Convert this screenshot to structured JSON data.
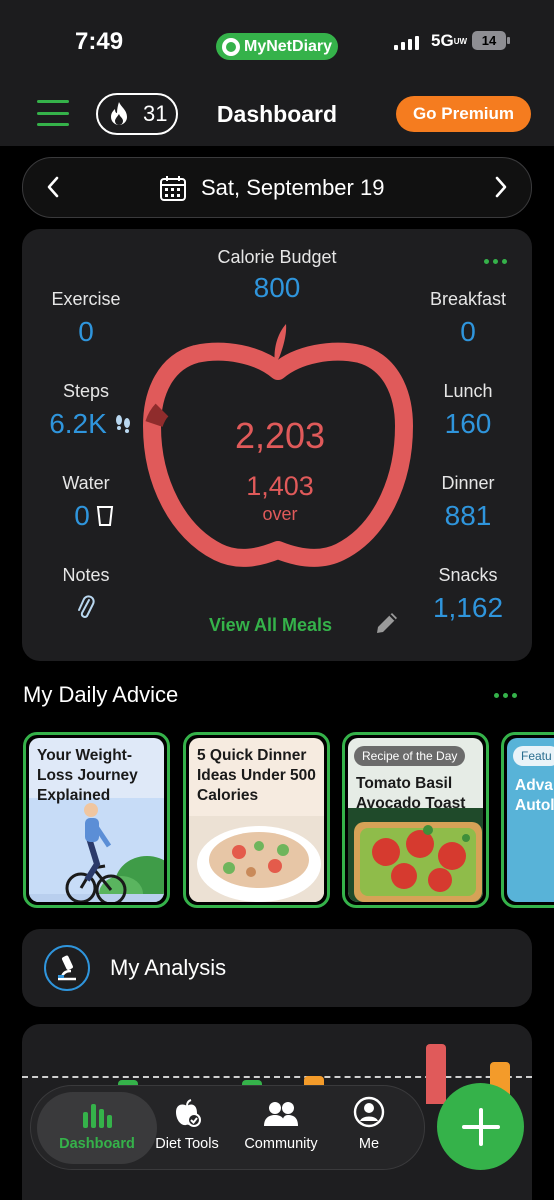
{
  "status_bar": {
    "time": "7:49",
    "app_name": "MyNetDiary",
    "network": "5G",
    "network_suffix": "UW",
    "battery": "14"
  },
  "header": {
    "title": "Dashboard",
    "streak_count": "31",
    "premium_label": "Go Premium"
  },
  "date_bar": {
    "date": "Sat, September 19"
  },
  "summary": {
    "calorie_budget_label": "Calorie Budget",
    "calorie_budget_value": "800",
    "exercise_label": "Exercise",
    "exercise_value": "0",
    "steps_label": "Steps",
    "steps_value": "6.2K",
    "water_label": "Water",
    "water_value": "0",
    "notes_label": "Notes",
    "breakfast_label": "Breakfast",
    "breakfast_value": "0",
    "lunch_label": "Lunch",
    "lunch_value": "160",
    "dinner_label": "Dinner",
    "dinner_value": "881",
    "snacks_label": "Snacks",
    "snacks_value": "1,162",
    "total_calories": "2,203",
    "over_value": "1,403",
    "over_label": "over",
    "view_all_meals": "View All Meals"
  },
  "advice": {
    "title": "My Daily Advice",
    "cards": [
      {
        "text": "Your Weight-Loss Journey Explained"
      },
      {
        "text": "5 Quick Dinner Ideas Under 500 Calories"
      },
      {
        "badge": "Recipe of the Day",
        "text": "Tomato Basil Avocado Toast"
      },
      {
        "badge": "Featu",
        "text": "Adva Autol"
      }
    ]
  },
  "analysis": {
    "title": "My Analysis"
  },
  "nav": {
    "items": [
      {
        "label": "Dashboard",
        "icon": "bar-chart-icon"
      },
      {
        "label": "Diet Tools",
        "icon": "apple-check-icon"
      },
      {
        "label": "Community",
        "icon": "people-icon"
      },
      {
        "label": "Me",
        "icon": "person-icon"
      }
    ]
  },
  "colors": {
    "accent_green": "#35b24a",
    "value_blue": "#2f95dc",
    "apple_red": "#e05a5a",
    "premium_orange": "#f57c1f"
  }
}
